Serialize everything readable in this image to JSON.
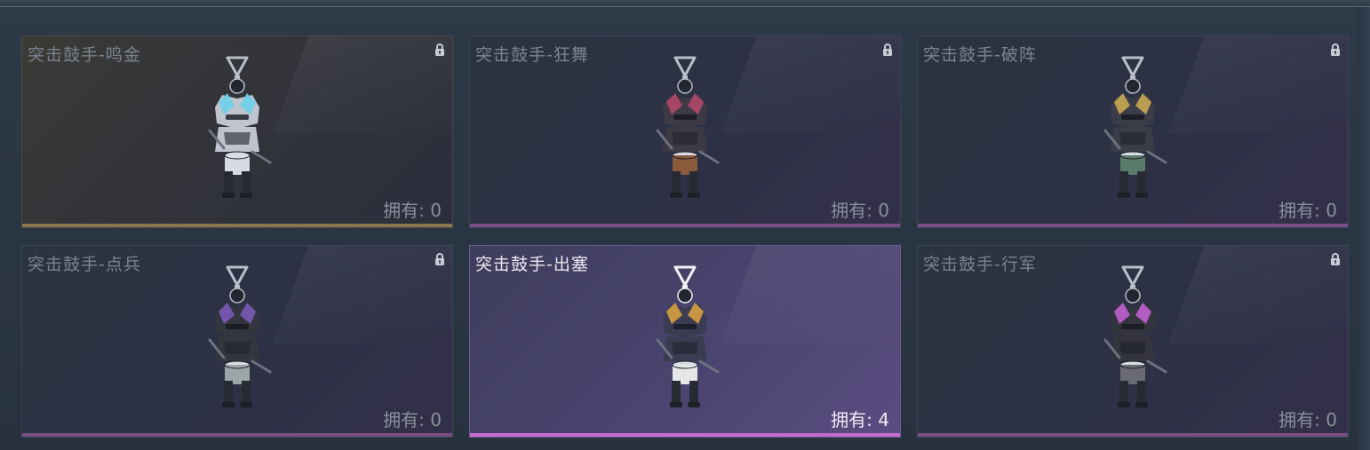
{
  "items": [
    {
      "name": "突击鼓手-鸣金",
      "owned": "拥有: 0",
      "locked": true,
      "rarity": "gold",
      "accent": "#6ad0e8",
      "drum": "#d8dce2",
      "body": "#bfc5cf"
    },
    {
      "name": "突击鼓手-狂舞",
      "owned": "拥有: 0",
      "locked": true,
      "rarity": "purple",
      "accent": "#b0486a",
      "drum": "#8a5a3c",
      "body": "#3d3a46"
    },
    {
      "name": "突击鼓手-破阵",
      "owned": "拥有: 0",
      "locked": true,
      "rarity": "purple",
      "accent": "#c8a850",
      "drum": "#5a7a6a",
      "body": "#3a3c48"
    },
    {
      "name": "突击鼓手-点兵",
      "owned": "拥有: 0",
      "locked": true,
      "rarity": "purple",
      "accent": "#7a5ab8",
      "drum": "#9aa6a8",
      "body": "#34363f"
    },
    {
      "name": "突击鼓手-出塞",
      "owned": "拥有: 4",
      "locked": false,
      "rarity": "purple",
      "accent": "#d8a040",
      "drum": "#e6e6e6",
      "body": "#3a3d52",
      "selected": true
    },
    {
      "name": "突击鼓手-行军",
      "owned": "拥有: 0",
      "locked": true,
      "rarity": "purple",
      "accent": "#c060d0",
      "drum": "#6a6a72",
      "body": "#33343e"
    }
  ],
  "icons": {
    "lock": "lock-icon",
    "figure": "drummer-pendant-figure"
  }
}
